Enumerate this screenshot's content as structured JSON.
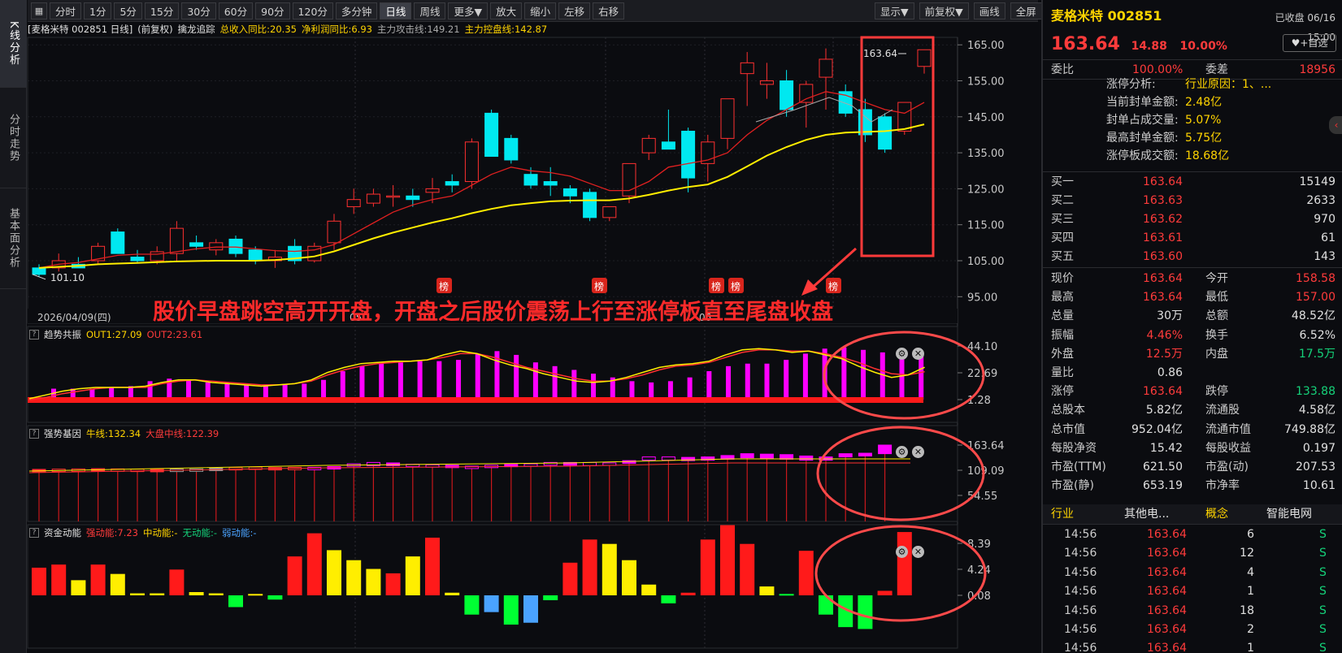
{
  "nav_tabs": [
    "K线分析",
    "分时走势",
    "基本面分析"
  ],
  "toolbar": {
    "periods": [
      "分时",
      "1分",
      "5分",
      "15分",
      "30分",
      "60分",
      "90分",
      "120分",
      "多分钟",
      "日线",
      "周线",
      "更多▼",
      "放大",
      "缩小",
      "左移",
      "右移"
    ],
    "active_period": "日线",
    "right_buttons": [
      "显示▼",
      "前复权▼",
      "画线",
      "全屏"
    ]
  },
  "info_line": {
    "stock": "[麦格米特 002851 日线]",
    "adj": "(前复权)",
    "indicator": "擒龙追踪",
    "rev": "总收入同比:20.35",
    "profit": "净利润同比:6.93",
    "attack": "主力攻击线:149.21",
    "control": "主力控盘线:142.87"
  },
  "main_chart": {
    "y_ticks": [
      "165.00",
      "155.00",
      "145.00",
      "135.00",
      "125.00",
      "115.00",
      "105.00",
      "95.00"
    ],
    "date_label": "2026/04/09(四)",
    "month_labels": [
      "05",
      "06"
    ],
    "low_label": "101.10",
    "high_label": "163.64",
    "bang_label": "榜",
    "annotation": "股价早盘跳空高开开盘，开盘之后股价震荡上行至涨停板直至尾盘收盘"
  },
  "panel1": {
    "title": "趋势共振",
    "out1": "OUT1:27.09",
    "out2": "OUT2:23.61",
    "ticks": [
      "44.10",
      "22.69",
      "1.28"
    ]
  },
  "panel2": {
    "title": "强势基因",
    "l1": "牛线:132.34",
    "l2": "大盘中线:122.39",
    "ticks": [
      "163.64",
      "109.09",
      "54.55"
    ]
  },
  "panel3": {
    "title": "资金动能",
    "s": "强动能:7.23",
    "m": "中动能:-",
    "n": "无动能:-",
    "w": "弱动能:-",
    "ticks": [
      "8.39",
      "4.24",
      "0.08"
    ]
  },
  "quote": {
    "name": "麦格米特 002851",
    "status": "已收盘 06/16 15:00",
    "price": "163.64",
    "chg": "14.88",
    "pct": "10.00%",
    "fav": "♥+自选",
    "weibi_label": "委比",
    "weibi": "100.00%",
    "weicha_label": "委差",
    "weicha": "18956",
    "limit_rows": [
      {
        "k": "涨停分析:",
        "v": "行业原因：1、..."
      },
      {
        "k": "当前封单金额:",
        "v": "2.48亿"
      },
      {
        "k": "封单占成交量:",
        "v": "5.07%"
      },
      {
        "k": "最高封单金额:",
        "v": "5.75亿"
      },
      {
        "k": "涨停板成交额:",
        "v": "18.68亿"
      }
    ],
    "bids": [
      {
        "k": "买一",
        "p": "163.64",
        "v": "15149"
      },
      {
        "k": "买二",
        "p": "163.63",
        "v": "2633"
      },
      {
        "k": "买三",
        "p": "163.62",
        "v": "970"
      },
      {
        "k": "买四",
        "p": "163.61",
        "v": "61"
      },
      {
        "k": "买五",
        "p": "163.60",
        "v": "143"
      }
    ],
    "stats": [
      {
        "k1": "现价",
        "v1": "163.64",
        "c1": "red",
        "k2": "今开",
        "v2": "158.58",
        "c2": "red"
      },
      {
        "k1": "最高",
        "v1": "163.64",
        "c1": "red",
        "k2": "最低",
        "v2": "157.00",
        "c2": "red"
      },
      {
        "k1": "总量",
        "v1": "30万",
        "c1": "wht",
        "k2": "总额",
        "v2": "48.52亿",
        "c2": "wht"
      },
      {
        "k1": "振幅",
        "v1": "4.46%",
        "c1": "red",
        "k2": "换手",
        "v2": "6.52%",
        "c2": "wht"
      },
      {
        "k1": "外盘",
        "v1": "12.5万",
        "c1": "red",
        "k2": "内盘",
        "v2": "17.5万",
        "c2": "grn"
      },
      {
        "k1": "量比",
        "v1": "0.86",
        "c1": "wht",
        "k2": "",
        "v2": "",
        "c2": "wht"
      },
      {
        "k1": "涨停",
        "v1": "163.64",
        "c1": "red",
        "k2": "跌停",
        "v2": "133.88",
        "c2": "grn"
      },
      {
        "k1": "总股本",
        "v1": "5.82亿",
        "c1": "wht",
        "k2": "流通股",
        "v2": "4.58亿",
        "c2": "wht"
      },
      {
        "k1": "总市值",
        "v1": "952.04亿",
        "c1": "wht",
        "k2": "流通市值",
        "v2": "749.88亿",
        "c2": "wht"
      },
      {
        "k1": "每股净资",
        "v1": "15.42",
        "c1": "wht",
        "k2": "每股收益",
        "v2": "0.197",
        "c2": "wht"
      },
      {
        "k1": "市盈(TTM)",
        "v1": "621.50",
        "c1": "wht",
        "k2": "市盈(动)",
        "v2": "207.53",
        "c2": "wht"
      },
      {
        "k1": "市盈(静)",
        "v1": "653.19",
        "c1": "wht",
        "k2": "市净率",
        "v2": "10.61",
        "c2": "wht"
      }
    ],
    "industry": {
      "k1": "行业",
      "v1": "其他电...",
      "k2": "概念",
      "v2": "智能电网"
    },
    "ticks": [
      {
        "t": "14:56",
        "p": "163.64",
        "v": "6",
        "d": "S"
      },
      {
        "t": "14:56",
        "p": "163.64",
        "v": "12",
        "d": "S"
      },
      {
        "t": "14:56",
        "p": "163.64",
        "v": "4",
        "d": "S"
      },
      {
        "t": "14:56",
        "p": "163.64",
        "v": "1",
        "d": "S"
      },
      {
        "t": "14:56",
        "p": "163.64",
        "v": "18",
        "d": "S"
      },
      {
        "t": "14:56",
        "p": "163.64",
        "v": "2",
        "d": "S"
      },
      {
        "t": "14:56",
        "p": "163.64",
        "v": "1",
        "d": "S"
      }
    ]
  },
  "chart_data": {
    "type": "candlestick",
    "candles": [
      [
        103,
        104,
        100.5,
        101.2
      ],
      [
        103,
        107,
        102,
        105
      ],
      [
        104,
        106,
        103,
        103
      ],
      [
        105,
        110,
        104,
        109
      ],
      [
        113,
        114,
        107,
        107
      ],
      [
        106,
        108,
        104.5,
        105
      ],
      [
        105,
        109,
        104,
        107.5
      ],
      [
        107,
        116,
        105,
        114
      ],
      [
        110,
        112,
        108,
        109
      ],
      [
        108,
        111,
        106.5,
        110
      ],
      [
        111,
        112,
        106,
        107
      ],
      [
        108,
        109,
        104,
        105
      ],
      [
        105,
        108,
        103,
        106
      ],
      [
        109,
        111,
        104,
        105
      ],
      [
        105,
        110,
        104.5,
        109
      ],
      [
        110,
        118,
        108,
        116
      ],
      [
        120,
        125,
        118,
        122
      ],
      [
        121,
        125,
        120,
        123.5
      ],
      [
        123,
        126,
        120,
        123
      ],
      [
        123,
        125,
        120,
        122
      ],
      [
        124,
        128,
        121,
        125
      ],
      [
        127,
        129,
        124,
        126
      ],
      [
        127,
        139,
        125,
        138
      ],
      [
        146,
        147,
        134,
        134
      ],
      [
        139,
        140,
        132,
        133
      ],
      [
        129,
        131,
        125,
        126
      ],
      [
        127,
        131,
        123,
        126
      ],
      [
        125,
        126,
        121,
        123
      ],
      [
        124,
        125,
        116,
        117
      ],
      [
        117,
        120,
        116,
        120
      ],
      [
        123,
        132,
        121,
        132
      ],
      [
        135,
        140,
        133,
        139
      ],
      [
        138,
        147,
        136,
        136
      ],
      [
        141,
        142,
        124,
        128
      ],
      [
        132,
        140,
        127,
        138
      ],
      [
        139,
        150,
        136,
        150
      ],
      [
        157,
        163,
        148,
        160
      ],
      [
        154,
        160,
        150,
        155
      ],
      [
        155,
        158,
        145,
        147
      ],
      [
        149,
        155,
        142,
        154
      ],
      [
        156,
        164,
        147,
        161
      ],
      [
        152,
        154,
        145,
        146
      ],
      [
        147,
        150,
        138,
        140
      ],
      [
        145,
        146,
        135,
        136
      ],
      [
        141,
        149,
        140,
        149
      ],
      [
        159,
        163.64,
        157,
        163.64
      ]
    ],
    "ma_fast": [
      103,
      104,
      104.5,
      105.5,
      106.5,
      106.8,
      106.8,
      107.5,
      108.3,
      108.8,
      108.8,
      108.3,
      107.8,
      107.6,
      108,
      109.5,
      112.5,
      115.5,
      118.5,
      120.5,
      122,
      123,
      126,
      129,
      131,
      130,
      129.5,
      128.5,
      126.5,
      124.5,
      124.5,
      127,
      131,
      132,
      133,
      135,
      140,
      144,
      147,
      150,
      152,
      151,
      149,
      147,
      146,
      149
    ],
    "ma_slow": [
      103,
      103.3,
      103.6,
      104,
      104.2,
      104.4,
      104.6,
      104.8,
      104.9,
      105,
      105,
      105,
      105.2,
      105.6,
      106.2,
      107.6,
      109.4,
      111.2,
      112.8,
      114.2,
      115.6,
      116.8,
      118.2,
      119.4,
      120.4,
      121.0,
      121.5,
      121.7,
      121.8,
      121.8,
      122.3,
      123.3,
      124.5,
      125.5,
      126.2,
      128.3,
      131.2,
      134.2,
      136.6,
      138.6,
      140.0,
      140.6,
      140.8,
      141.0,
      141.6,
      142.9
    ],
    "p1_bars": [
      4,
      7,
      9,
      10,
      10,
      10,
      11,
      12,
      16,
      18,
      17,
      15,
      14,
      13,
      12,
      13,
      14,
      17,
      24,
      28,
      30,
      31,
      32,
      32,
      33,
      38,
      40,
      37,
      31,
      28,
      25,
      22,
      19,
      16,
      15,
      16,
      19,
      24,
      28,
      30,
      30,
      33,
      38,
      42,
      43,
      41,
      39,
      40,
      36,
      33,
      27,
      22,
      20,
      24,
      27
    ],
    "p1_out1": [
      2,
      5,
      8,
      10,
      11,
      11,
      11,
      12,
      15,
      17,
      17,
      15,
      14,
      13,
      12,
      13,
      14,
      17,
      23,
      27,
      30,
      31,
      32,
      32,
      33,
      37,
      40,
      38,
      33,
      29,
      26,
      22,
      19,
      16,
      15,
      16,
      19,
      23,
      27,
      29,
      30,
      32,
      37,
      41,
      42,
      41,
      39,
      40,
      37,
      34,
      28,
      23,
      19,
      21,
      27.09
    ],
    "p1_out2": [
      1,
      3,
      6,
      8,
      10,
      11,
      11,
      11,
      14,
      16,
      17,
      16,
      15,
      14,
      13,
      13,
      14,
      16,
      21,
      25,
      28,
      30,
      31,
      32,
      33,
      35,
      38,
      38,
      35,
      31,
      27,
      24,
      21,
      18,
      16,
      16,
      18,
      21,
      25,
      28,
      29,
      31,
      35,
      39,
      41,
      41,
      40,
      40,
      38,
      35,
      31,
      26,
      22,
      21,
      23.61
    ],
    "p2_bodies": [
      [
        109.5,
        111
      ],
      [
        110,
        111.5
      ],
      [
        110,
        112
      ],
      [
        110.5,
        112.5
      ],
      [
        110,
        112
      ],
      [
        110,
        111.5
      ],
      [
        109.5,
        111
      ],
      [
        110,
        111.5
      ],
      [
        110,
        112
      ],
      [
        111,
        113.5
      ],
      [
        112,
        115
      ],
      [
        113,
        116
      ],
      [
        112,
        115
      ],
      [
        113,
        115.5
      ],
      [
        113,
        115.5
      ],
      [
        114,
        117
      ],
      [
        118,
        123
      ],
      [
        119,
        126
      ],
      [
        119,
        125
      ],
      [
        118,
        122
      ],
      [
        117,
        121
      ],
      [
        116,
        120
      ],
      [
        115,
        118
      ],
      [
        116,
        120
      ],
      [
        117,
        122
      ],
      [
        118,
        123
      ],
      [
        120,
        126
      ],
      [
        120,
        126
      ],
      [
        119,
        126
      ],
      [
        120,
        125
      ],
      [
        124,
        130
      ],
      [
        131,
        138
      ],
      [
        131,
        138
      ],
      [
        130,
        137
      ],
      [
        131,
        138
      ],
      [
        133,
        141
      ],
      [
        136,
        145
      ],
      [
        134,
        144
      ],
      [
        133,
        143
      ],
      [
        131,
        140
      ],
      [
        131,
        138
      ],
      [
        138,
        145
      ],
      [
        140,
        146
      ],
      [
        145,
        163.64
      ]
    ],
    "p3_bars": [
      4.5,
      5,
      2.5,
      5,
      3.5,
      0.4,
      0.4,
      4.2,
      0.6,
      0.4,
      -1.8,
      0.3,
      -0.6,
      6.3,
      10,
      7.3,
      5.7,
      4.3,
      3.6,
      6.3,
      9.3,
      0.5,
      -3,
      -2.6,
      -4.6,
      -4.3,
      -0.7,
      5.3,
      9,
      8.3,
      5.7,
      1.8,
      -1.2,
      0.5,
      9,
      11.3,
      8.3,
      1.5,
      0.3,
      7.2,
      -3,
      -5,
      -5.3,
      0.8,
      10.2
    ],
    "p3_colors": [
      "red",
      "red",
      "yel",
      "red",
      "yel",
      "yel",
      "yel",
      "red",
      "yel",
      "yel",
      "grn",
      "yel",
      "grn",
      "red",
      "red",
      "yel",
      "yel",
      "yel",
      "red",
      "yel",
      "red",
      "yel",
      "grn",
      "blu",
      "grn",
      "blu",
      "grn",
      "red",
      "red",
      "yel",
      "yel",
      "yel",
      "grn",
      "red",
      "red",
      "red",
      "red",
      "yel",
      "grn",
      "red",
      "grn",
      "grn",
      "grn",
      "red",
      "red"
    ]
  }
}
